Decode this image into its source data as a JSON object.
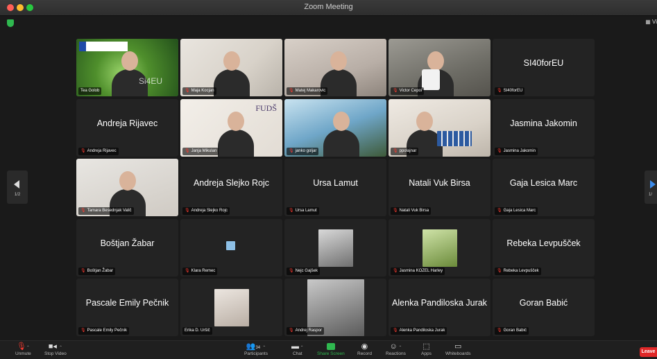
{
  "window": {
    "title": "Zoom Meeting"
  },
  "topbar": {
    "view_label": "Vi"
  },
  "nav": {
    "left_page": "1/2",
    "right_page": "1/"
  },
  "tiles": [
    {
      "display_name": "",
      "label": "Tea Golob",
      "muted": false,
      "has_video": true
    },
    {
      "display_name": "",
      "label": "Maja Kocjan",
      "muted": true,
      "has_video": true
    },
    {
      "display_name": "",
      "label": "Matej Makarovic",
      "muted": true,
      "has_video": true
    },
    {
      "display_name": "",
      "label": "Victor Cepoi",
      "muted": true,
      "has_video": true
    },
    {
      "display_name": "SI40forEU",
      "label": "SI40forEU",
      "muted": true,
      "has_video": false
    },
    {
      "display_name": "Andreja Rijavec",
      "label": "Andreja Rijavec",
      "muted": true,
      "has_video": false
    },
    {
      "display_name": "",
      "label": "Janja Mikulan",
      "muted": true,
      "has_video": true
    },
    {
      "display_name": "",
      "label": "janko goljar",
      "muted": true,
      "has_video": true
    },
    {
      "display_name": "",
      "label": "ppolajnar",
      "muted": true,
      "has_video": true
    },
    {
      "display_name": "Jasmina Jakomin",
      "label": "Jasmina Jakomin",
      "muted": true,
      "has_video": false
    },
    {
      "display_name": "",
      "label": "Tamara Besednjak Valič",
      "muted": true,
      "has_video": true
    },
    {
      "display_name": "Andreja Slejko Rojc",
      "label": "Andreja Slejko Rojc",
      "muted": true,
      "has_video": false
    },
    {
      "display_name": "Ursa Lamut",
      "label": "Ursa Lamut",
      "muted": true,
      "has_video": false
    },
    {
      "display_name": "Natali Vuk Birsa",
      "label": "Natali Vuk Birsa",
      "muted": true,
      "has_video": false
    },
    {
      "display_name": "Gaja Lesica Marc",
      "label": "Gaja Lesica Marc",
      "muted": true,
      "has_video": false
    },
    {
      "display_name": "Boštjan Žabar",
      "label": "Boštjan Žabar",
      "muted": true,
      "has_video": false
    },
    {
      "display_name": "",
      "label": "Klara Remec",
      "muted": true,
      "has_video": false
    },
    {
      "display_name": "",
      "label": "Nejc Gajšek",
      "muted": true,
      "has_video": false
    },
    {
      "display_name": "",
      "label": "Jasmina KOZEL Harley",
      "muted": true,
      "has_video": false
    },
    {
      "display_name": "Rebeka Levpušček",
      "label": "Rebeka Levpušček",
      "muted": true,
      "has_video": false
    },
    {
      "display_name": "Pascale Emily Pečnik",
      "label": "Pascale Emily Pečnik",
      "muted": true,
      "has_video": false
    },
    {
      "display_name": "",
      "label": "Erika D. Uršič",
      "muted": false,
      "has_video": false
    },
    {
      "display_name": "",
      "label": "Andrej Raspor",
      "muted": true,
      "has_video": false
    },
    {
      "display_name": "Alenka Pandiloska Jurak",
      "label": "Alenka Pandiloska Jurak",
      "muted": true,
      "has_video": false
    },
    {
      "display_name": "Goran Babić",
      "label": "Goran Babić",
      "muted": true,
      "has_video": false
    }
  ],
  "toolbar": {
    "unmute": "Unmute",
    "stop_video": "Stop Video",
    "participants": "Participants",
    "participants_count": "34",
    "chat": "Chat",
    "share_screen": "Share Screen",
    "record": "Record",
    "reactions": "Reactions",
    "apps": "Apps",
    "whiteboards": "Whiteboards",
    "leave": "Leave"
  },
  "colors": {
    "active_speaker": "#3ccf4e",
    "muted_icon": "#ff3b30",
    "leave": "#e02828",
    "share": "#2fb84f"
  },
  "video_texts": {
    "fuds_logo": "FUDŠ",
    "tile0_overlay": "Si4EU"
  }
}
